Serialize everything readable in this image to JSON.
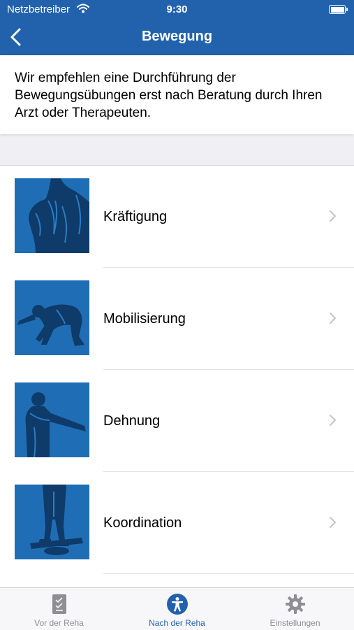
{
  "status_bar": {
    "carrier": "Netzbetreiber",
    "time": "9:30"
  },
  "nav": {
    "title": "Bewegung",
    "back_icon": "chevron-left-icon"
  },
  "notice": {
    "text": "Wir empfehlen eine Durchführung der Bewegungsübungen erst nach Beratung durch Ihren Arzt oder Therapeuten."
  },
  "exercises": [
    {
      "label": "Kräftigung",
      "image": "back-muscles-figure"
    },
    {
      "label": "Mobilisierung",
      "image": "kneeling-stretch-figure"
    },
    {
      "label": "Dehnung",
      "image": "arm-stretch-figure"
    },
    {
      "label": "Koordination",
      "image": "balance-board-figure"
    }
  ],
  "tab_bar": {
    "tabs": [
      {
        "label": "Vor der Reha",
        "icon": "checklist-icon",
        "active": false
      },
      {
        "label": "Nach der Reha",
        "icon": "person-icon",
        "active": true
      },
      {
        "label": "Einstellungen",
        "icon": "gear-icon",
        "active": false
      }
    ]
  },
  "colors": {
    "brand": "#2262ad",
    "thumb_background": "#1f6db5",
    "inactive_tab": "#8e8e93",
    "page_background": "#efeff4"
  }
}
